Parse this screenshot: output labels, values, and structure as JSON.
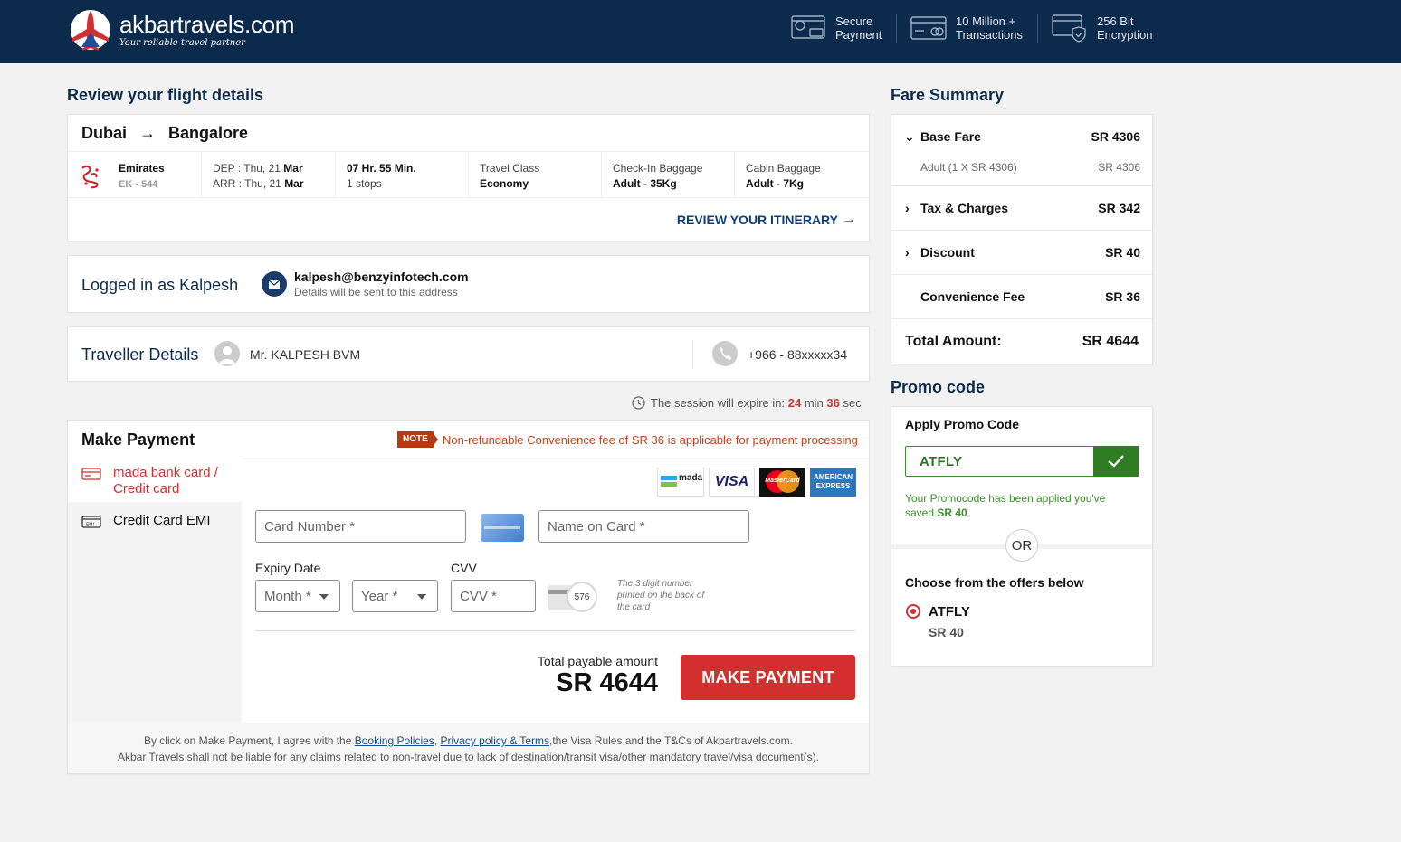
{
  "header": {
    "brand": "akbartravels.com",
    "tagline": "Your reliable travel partner",
    "badges": [
      {
        "line1": "Secure",
        "line2": "Payment"
      },
      {
        "line1": "10 Million +",
        "line2": "Transactions"
      },
      {
        "line1": "256 Bit",
        "line2": "Encryption"
      }
    ]
  },
  "flight": {
    "section_title": "Review your flight details",
    "from": "Dubai",
    "to": "Bangalore",
    "airline": "Emirates",
    "flight_no": "EK - 544",
    "dep_label": "DEP :",
    "dep_day": "Thu, 21",
    "dep_month": "Mar",
    "arr_label": "ARR :",
    "arr_day": "Thu, 21",
    "arr_month": "Mar",
    "duration": "07 Hr. 55 Min.",
    "stops": "1 stops",
    "class_label": "Travel Class",
    "class_value": "Economy",
    "checkin_label": "Check-In Baggage",
    "checkin_value": "Adult - 35Kg",
    "cabin_label": "Cabin Baggage",
    "cabin_value": "Adult - 7Kg",
    "review_link": "REVIEW YOUR ITINERARY"
  },
  "login": {
    "label": "Logged in as Kalpesh",
    "email": "kalpesh@benzyinfotech.com",
    "email_note": "Details will be sent to this address"
  },
  "traveller": {
    "label": "Traveller Details",
    "name": "Mr. KALPESH BVM",
    "phone": "+966 - 88xxxxx34"
  },
  "session": {
    "prefix": "The session will expire in:",
    "minutes": "24",
    "min_label": "min",
    "seconds": "36",
    "sec_label": "sec"
  },
  "payment": {
    "title": "Make Payment",
    "note_tag": "NOTE",
    "note_text": "Non-refundable Convenience fee of SR 36 is applicable for payment processing",
    "options": [
      {
        "line1": "mada bank card /",
        "line2": "Credit card"
      },
      {
        "line1": "Credit Card EMI"
      }
    ],
    "card_logos": [
      "mada",
      "VISA",
      "MasterCard",
      "AMERICAN EXPRESS"
    ],
    "card_number_ph": "Card Number *",
    "name_on_card_ph": "Name on Card *",
    "expiry_label": "Expiry Date",
    "month_ph": "Month *",
    "year_ph": "Year *",
    "cvv_label": "CVV",
    "cvv_ph": "CVV *",
    "cvv_sample": "576",
    "cvv_hint": "The 3 digit number printed on the back of the card",
    "total_label": "Total payable amount",
    "total_value": "SR 4644",
    "pay_button": "MAKE PAYMENT",
    "terms_prefix": "By click on Make Payment, I agree with the",
    "terms_link1": "Booking Policies",
    "terms_comma": ",",
    "terms_link2": "Privacy policy & Terms",
    "terms_suffix": ",the Visa Rules and the T&Cs of Akbartravels.com.",
    "disclaimer": "Akbar Travels shall not be liable for any claims related to non-travel due to lack of destination/transit visa/other mandatory travel/visa document(s)."
  },
  "fare": {
    "title": "Fare Summary",
    "base_label": "Base Fare",
    "base_value": "SR 4306",
    "adult_label": "Adult (1 X SR 4306)",
    "adult_value": "SR 4306",
    "tax_label": "Tax & Charges",
    "tax_value": "SR 342",
    "discount_label": "Discount",
    "discount_value": "SR 40",
    "conv_label": "Convenience Fee",
    "conv_value": "SR 36",
    "total_label": "Total Amount:",
    "total_value": "SR 4644"
  },
  "promo": {
    "title": "Promo code",
    "apply_label": "Apply Promo Code",
    "code_value": "ATFLY",
    "success_prefix": "Your Promocode has been applied you've saved",
    "success_amount": "SR 40",
    "or_label": "OR",
    "offers_label": "Choose from the offers below",
    "offer_code": "ATFLY",
    "offer_amount": "SR 40"
  },
  "colors": {
    "header_bg": "#0c2a4b",
    "accent_red": "#d32f2f",
    "promo_green": "#2e7d22",
    "link_blue": "#0c3f7a"
  }
}
